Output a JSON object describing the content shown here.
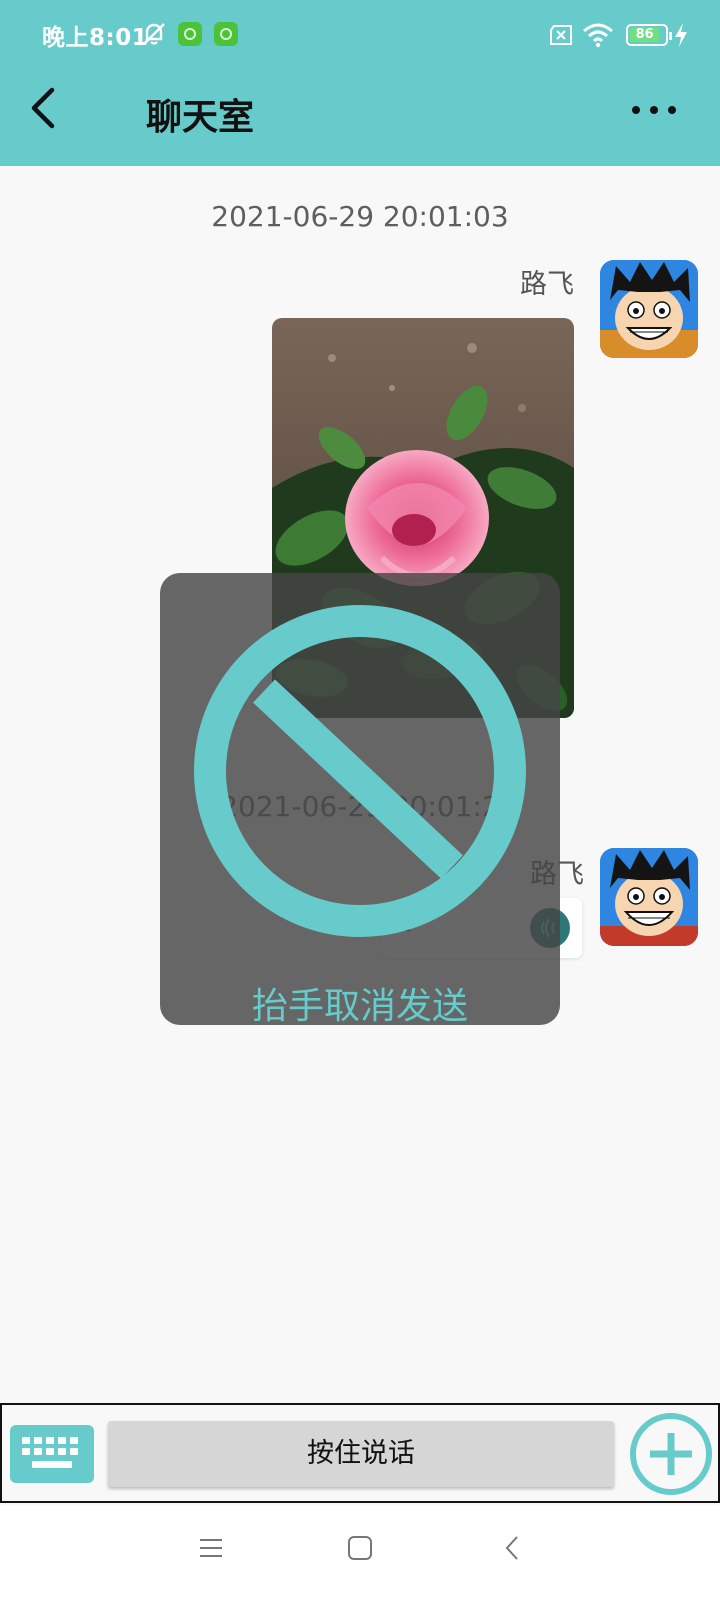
{
  "status_bar": {
    "time": "晚上8:01",
    "battery_level": "86",
    "icons": [
      "mute-bell-icon",
      "app-badge-icon",
      "app-badge-icon",
      "no-sim-icon",
      "wifi-icon",
      "battery-icon",
      "charging-icon"
    ]
  },
  "header": {
    "title": "聊天室",
    "back_icon": "chevron-left-icon",
    "more_icon": "more-dots-icon",
    "background_color": "#67cbcb"
  },
  "messages": [
    {
      "timestamp": "2021-06-29 20:01:03",
      "sender": "路飞",
      "type": "image",
      "image_subject": "pink rose with green leaves"
    },
    {
      "timestamp": "2021-06-29 20:01:2",
      "sender": "路飞",
      "type": "voice",
      "duration": "1\""
    }
  ],
  "recording_overlay": {
    "label": "抬手取消发送",
    "icon": "prohibited-icon",
    "accent_color": "#67cbcb"
  },
  "input_bar": {
    "keyboard_icon": "keyboard-icon",
    "hold_to_talk_label": "按住说话",
    "plus_icon": "plus-circle-icon"
  },
  "nav_bar": {
    "icons": [
      "menu-icon",
      "home-square-icon",
      "back-chevron-icon"
    ]
  }
}
